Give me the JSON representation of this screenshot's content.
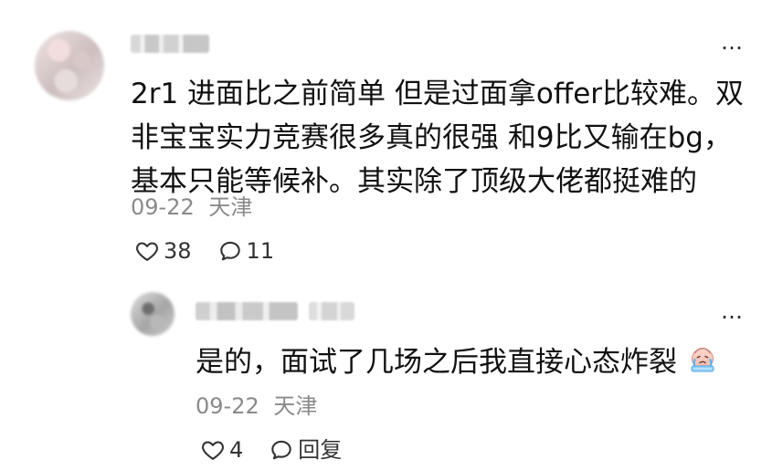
{
  "comments": [
    {
      "author_label": "",
      "content": "2r1 进面比之前简单 但是过面拿offer比较难。双非宝宝实力竞赛很多真的很强 和9比又输在bg，基本只能等候补。其实除了顶级大佬都挺难的",
      "date": "09-22",
      "location": "天津",
      "like_count": "38",
      "comment_count": "11",
      "more_glyph": "…",
      "icons": {
        "like": "heart-outline-icon",
        "comment": "speech-bubble-outline-icon",
        "more": "ellipsis-icon"
      }
    },
    {
      "author_label": "",
      "content": "是的，面试了几场之后我直接心态炸裂",
      "emoji_name": "crying-emoji-icon",
      "date": "09-22",
      "location": "天津",
      "like_count": "4",
      "reply_label": "回复",
      "more_glyph": "…",
      "icons": {
        "like": "heart-outline-icon",
        "reply": "speech-bubble-outline-icon",
        "more": "ellipsis-icon"
      }
    }
  ],
  "colors": {
    "background": "#ffffff",
    "text_primary": "#111111",
    "text_secondary": "#8a8a8a",
    "icon": "#333333"
  }
}
